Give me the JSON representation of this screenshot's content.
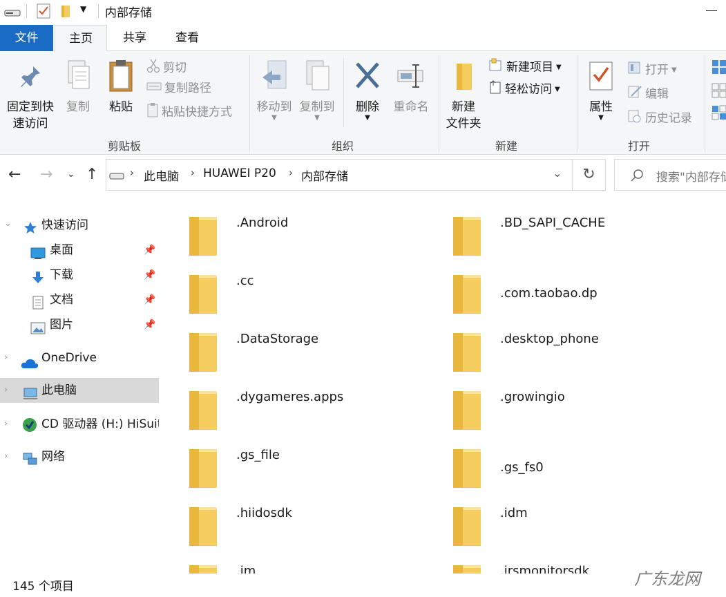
{
  "window": {
    "title": "内部存储"
  },
  "tabs": [
    {
      "label": "文件"
    },
    {
      "label": "主页"
    },
    {
      "label": "共享"
    },
    {
      "label": "查看"
    }
  ],
  "ribbon": {
    "clipboard": {
      "label": "剪贴板",
      "pin_quick_access": [
        "固定到快",
        "速访问"
      ],
      "copy": "复制",
      "paste": "粘贴",
      "cut": "剪切",
      "copy_path": "复制路径",
      "paste_shortcut": "粘贴快捷方式"
    },
    "organize": {
      "label": "组织",
      "move_to": "移动到",
      "copy_to": "复制到",
      "delete": "删除",
      "rename": "重命名"
    },
    "new": {
      "label": "新建",
      "new_folder": [
        "新建",
        "文件夹"
      ],
      "new_item": "新建项目",
      "easy_access": "轻松访问"
    },
    "open": {
      "label": "打开",
      "properties": "属性",
      "open": "打开",
      "edit": "编辑",
      "history": "历史记录"
    }
  },
  "address": {
    "breadcrumbs": [
      "此电脑",
      "HUAWEI P20",
      "内部存储"
    ]
  },
  "search": {
    "placeholder": "搜索\"内部存储\""
  },
  "sidebar": {
    "items": [
      {
        "label": "快速访问",
        "icon": "star-icon"
      },
      {
        "label": "桌面",
        "icon": "desktop-icon"
      },
      {
        "label": "下载",
        "icon": "download-icon"
      },
      {
        "label": "文档",
        "icon": "document-icon"
      },
      {
        "label": "图片",
        "icon": "picture-icon"
      },
      {
        "label": "OneDrive",
        "icon": "cloud-icon"
      },
      {
        "label": "此电脑",
        "icon": "computer-icon"
      },
      {
        "label": "CD 驱动器 (H:) HiSuite",
        "icon": "cd-drive-icon"
      },
      {
        "label": "网络",
        "icon": "network-icon"
      }
    ]
  },
  "folders": [
    {
      "name": ".Android"
    },
    {
      "name": ".BD_SAPI_CACHE"
    },
    {
      "name": ".cc"
    },
    {
      "name": ".com.taobao.dp"
    },
    {
      "name": ".DataStorage"
    },
    {
      "name": ".desktop_phone"
    },
    {
      "name": ".dygameres.apps"
    },
    {
      "name": ".growingio"
    },
    {
      "name": ".gs_file"
    },
    {
      "name": ".gs_fs0"
    },
    {
      "name": ".hiidosdk"
    },
    {
      "name": ".idm"
    },
    {
      "name": ".im"
    },
    {
      "name": ".irsmonitorsdk"
    }
  ],
  "status": {
    "count": "145 个项目"
  },
  "watermark": "广东龙网",
  "colors": {
    "accent": "#1a6bc4",
    "folder": "#f5cd5e",
    "selected": "#d9d9d9"
  }
}
